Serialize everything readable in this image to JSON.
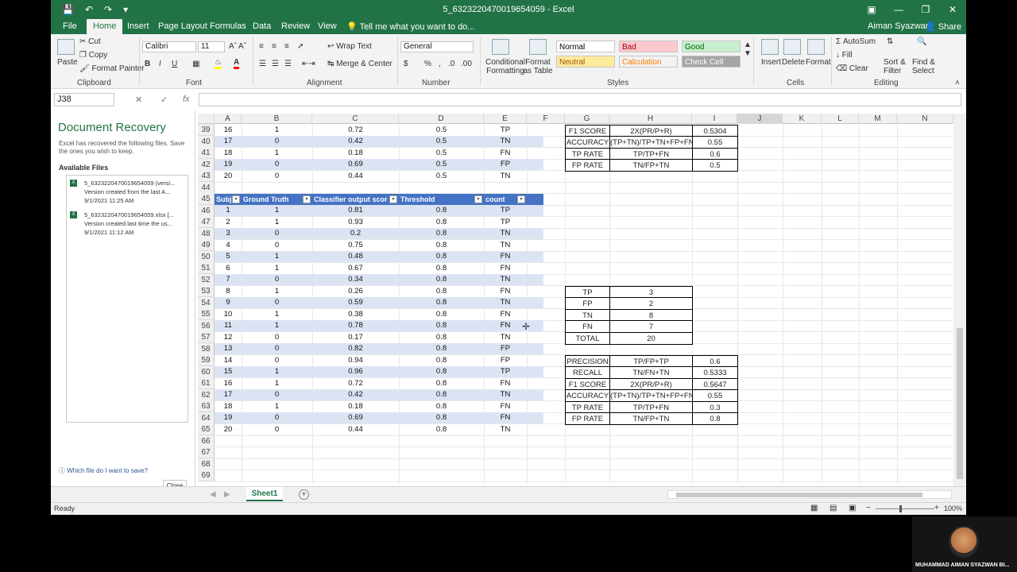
{
  "window": {
    "title": "5_6323220470019654059  -  Excel",
    "user": "Aiman Syazwan",
    "share": "Share"
  },
  "tabs": [
    "File",
    "Home",
    "Insert",
    "Page Layout",
    "Formulas",
    "Data",
    "Review",
    "View"
  ],
  "active_tab": "Home",
  "tell_me": "Tell me what you want to do...",
  "ribbon": {
    "clipboard": {
      "paste": "Paste",
      "cut": "Cut",
      "copy": "Copy",
      "format_painter": "Format Painter",
      "label": "Clipboard"
    },
    "font": {
      "name": "Calibri",
      "size": "11",
      "bold": "B",
      "italic": "I",
      "underline": "U",
      "label": "Font"
    },
    "alignment": {
      "wrap": "Wrap Text",
      "merge": "Merge & Center",
      "label": "Alignment"
    },
    "number": {
      "format": "General",
      "dollar": "$",
      "percent": "%",
      "comma": ",",
      "label": "Number"
    },
    "styles": {
      "conditional": "Conditional Formatting",
      "format_as_table": "Format as Table",
      "cells": [
        {
          "name": "Normal",
          "bg": "#ffffff",
          "fg": "#000000"
        },
        {
          "name": "Bad",
          "bg": "#ffc7ce",
          "fg": "#9c0006"
        },
        {
          "name": "Good",
          "bg": "#c6efce",
          "fg": "#006100"
        },
        {
          "name": "Neutral",
          "bg": "#ffeb9c",
          "fg": "#9c5700"
        },
        {
          "name": "Calculation",
          "bg": "#f2f2f2",
          "fg": "#fa7d00"
        },
        {
          "name": "Check Cell",
          "bg": "#a5a5a5",
          "fg": "#ffffff"
        }
      ],
      "label": "Styles"
    },
    "cells": {
      "insert": "Insert",
      "delete": "Delete",
      "format": "Format",
      "label": "Cells"
    },
    "editing": {
      "autosum": "AutoSum",
      "fill": "Fill",
      "clear": "Clear",
      "sort": "Sort & Filter",
      "find": "Find & Select",
      "label": "Editing"
    }
  },
  "formula_bar": {
    "name_box": "J38",
    "fx": "fx",
    "value": ""
  },
  "recovery": {
    "title": "Document Recovery",
    "desc": "Excel has recovered the following files.  Save the ones you wish to keep.",
    "available": "Available Files",
    "files": [
      {
        "name": "5_6323220470019654059 (versi...",
        "desc": "Version created from the last A...",
        "time": "9/1/2021 11:25 AM"
      },
      {
        "name": "5_6323220470019654059.xlsx  [...",
        "desc": "Version created last time the us...",
        "time": "9/1/2021 11:12 AM"
      }
    ],
    "help": "Which file do I want to save?",
    "close": "Close"
  },
  "columns": [
    "A",
    "B",
    "C",
    "D",
    "E",
    "F",
    "G",
    "H",
    "I",
    "J",
    "K",
    "L",
    "M",
    "N"
  ],
  "rows_top": [
    {
      "row": "39",
      "a": "16",
      "b": "1",
      "c": "0.72",
      "d": "0.5",
      "e": "TP"
    },
    {
      "row": "40",
      "a": "17",
      "b": "0",
      "c": "0.42",
      "d": "0.5",
      "e": "TN"
    },
    {
      "row": "41",
      "a": "18",
      "b": "1",
      "c": "0.18",
      "d": "0.5",
      "e": "FN"
    },
    {
      "row": "42",
      "a": "19",
      "b": "0",
      "c": "0.69",
      "d": "0.5",
      "e": "FP"
    },
    {
      "row": "43",
      "a": "20",
      "b": "0",
      "c": "0.44",
      "d": "0.5",
      "e": "TN"
    }
  ],
  "empty_rows_a": [
    "44"
  ],
  "table_header": {
    "row": "45",
    "cols": [
      "Subject",
      "Ground Truth",
      "Classifier output scor",
      "Threshold",
      "count"
    ]
  },
  "table_rows": [
    {
      "row": "46",
      "a": "1",
      "b": "1",
      "c": "0.81",
      "d": "0.8",
      "e": "TP"
    },
    {
      "row": "47",
      "a": "2",
      "b": "1",
      "c": "0.93",
      "d": "0.8",
      "e": "TP"
    },
    {
      "row": "48",
      "a": "3",
      "b": "0",
      "c": "0.2",
      "d": "0.8",
      "e": "TN"
    },
    {
      "row": "49",
      "a": "4",
      "b": "0",
      "c": "0.75",
      "d": "0.8",
      "e": "TN"
    },
    {
      "row": "50",
      "a": "5",
      "b": "1",
      "c": "0.48",
      "d": "0.8",
      "e": "FN"
    },
    {
      "row": "51",
      "a": "6",
      "b": "1",
      "c": "0.67",
      "d": "0.8",
      "e": "FN"
    },
    {
      "row": "52",
      "a": "7",
      "b": "0",
      "c": "0.34",
      "d": "0.8",
      "e": "TN"
    },
    {
      "row": "53",
      "a": "8",
      "b": "1",
      "c": "0.26",
      "d": "0.8",
      "e": "FN"
    },
    {
      "row": "54",
      "a": "9",
      "b": "0",
      "c": "0.59",
      "d": "0.8",
      "e": "TN"
    },
    {
      "row": "55",
      "a": "10",
      "b": "1",
      "c": "0.38",
      "d": "0.8",
      "e": "FN"
    },
    {
      "row": "56",
      "a": "11",
      "b": "1",
      "c": "0.78",
      "d": "0.8",
      "e": "FN"
    },
    {
      "row": "57",
      "a": "12",
      "b": "0",
      "c": "0.17",
      "d": "0.8",
      "e": "TN"
    },
    {
      "row": "58",
      "a": "13",
      "b": "0",
      "c": "0.82",
      "d": "0.8",
      "e": "FP"
    },
    {
      "row": "59",
      "a": "14",
      "b": "0",
      "c": "0.94",
      "d": "0.8",
      "e": "FP"
    },
    {
      "row": "60",
      "a": "15",
      "b": "1",
      "c": "0.96",
      "d": "0.8",
      "e": "TP"
    },
    {
      "row": "61",
      "a": "16",
      "b": "1",
      "c": "0.72",
      "d": "0.8",
      "e": "FN"
    },
    {
      "row": "62",
      "a": "17",
      "b": "0",
      "c": "0.42",
      "d": "0.8",
      "e": "TN"
    },
    {
      "row": "63",
      "a": "18",
      "b": "1",
      "c": "0.18",
      "d": "0.8",
      "e": "FN"
    },
    {
      "row": "64",
      "a": "19",
      "b": "0",
      "c": "0.69",
      "d": "0.8",
      "e": "FN"
    },
    {
      "row": "65",
      "a": "20",
      "b": "0",
      "c": "0.44",
      "d": "0.8",
      "e": "TN"
    }
  ],
  "empty_rows_b": [
    "66",
    "67",
    "68",
    "69"
  ],
  "metrics_top": [
    {
      "g": "F1 SCORE",
      "h": "2X(PR/P+R)",
      "i": "0.5304"
    },
    {
      "g": "ACCURACY",
      "h": "(TP+TN)/TP+TN+FP+FN",
      "i": "0.55"
    },
    {
      "g": "TP RATE",
      "h": "TP/TP+FN",
      "i": "0.6"
    },
    {
      "g": "FP RATE",
      "h": "TN/FP+TN",
      "i": "0.5"
    }
  ],
  "counts": [
    {
      "g": "TP",
      "h": "3"
    },
    {
      "g": "FP",
      "h": "2"
    },
    {
      "g": "TN",
      "h": "8"
    },
    {
      "g": "FN",
      "h": "7"
    },
    {
      "g": "TOTAL",
      "h": "20"
    }
  ],
  "metrics_bottom": [
    {
      "g": "PRECISION",
      "h": "TP/FP+TP",
      "i": "0.6"
    },
    {
      "g": "RECALL",
      "h": "TN/FN+TN",
      "i": "0.5333"
    },
    {
      "g": "F1 SCORE",
      "h": "2X(PR/P+R)",
      "i": "0.5647"
    },
    {
      "g": "ACCURACY",
      "h": "(TP+TN)/TP+TN+FP+FN",
      "i": "0.55"
    },
    {
      "g": "TP RATE",
      "h": "TP/TP+FN",
      "i": "0.3"
    },
    {
      "g": "FP RATE",
      "h": "TN/FP+TN",
      "i": "0.8"
    }
  ],
  "sheet_tab": "Sheet1",
  "status": {
    "ready": "Ready",
    "zoom": "100%"
  },
  "webcam": {
    "name": "MUHAMMAD AIMAN SYAZWAN BI..."
  }
}
